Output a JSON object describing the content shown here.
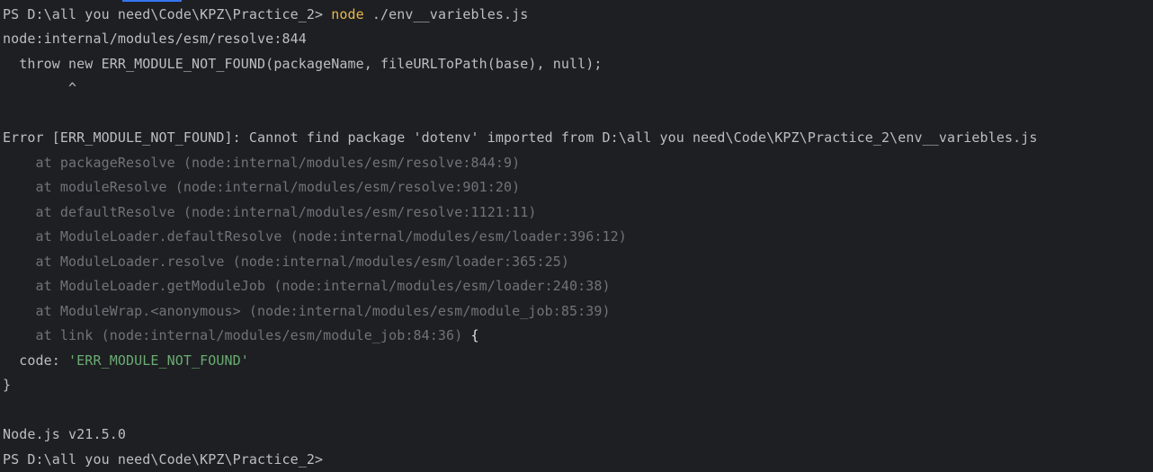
{
  "terminal": {
    "prompt": "PS D:\\all you need\\Code\\KPZ\\Practice_2> ",
    "command": "node",
    "command_args": " ./env__variebles.js",
    "output": {
      "location": "node:internal/modules/esm/resolve:844",
      "throw_line": "  throw new ERR_MODULE_NOT_FOUND(packageName, fileURLToPath(base), null);",
      "caret": "        ^",
      "error_message": "Error [ERR_MODULE_NOT_FOUND]: Cannot find package 'dotenv' imported from D:\\all you need\\Code\\KPZ\\Practice_2\\env__variebles.js",
      "stack": [
        "    at packageResolve (node:internal/modules/esm/resolve:844:9)",
        "    at moduleResolve (node:internal/modules/esm/resolve:901:20)",
        "    at defaultResolve (node:internal/modules/esm/resolve:1121:11)",
        "    at ModuleLoader.defaultResolve (node:internal/modules/esm/loader:396:12)",
        "    at ModuleLoader.resolve (node:internal/modules/esm/loader:365:25)",
        "    at ModuleLoader.getModuleJob (node:internal/modules/esm/loader:240:38)",
        "    at ModuleWrap.<anonymous> (node:internal/modules/esm/module_job:85:39)",
        "    at link (node:internal/modules/esm/module_job:84:36)"
      ],
      "stack_last_suffix": " {",
      "code_key": "  code: ",
      "code_value": "'ERR_MODULE_NOT_FOUND'",
      "close_brace": "}",
      "node_version": "Node.js v21.5.0"
    },
    "final_prompt": "PS D:\\all you need\\Code\\KPZ\\Practice_2>"
  }
}
